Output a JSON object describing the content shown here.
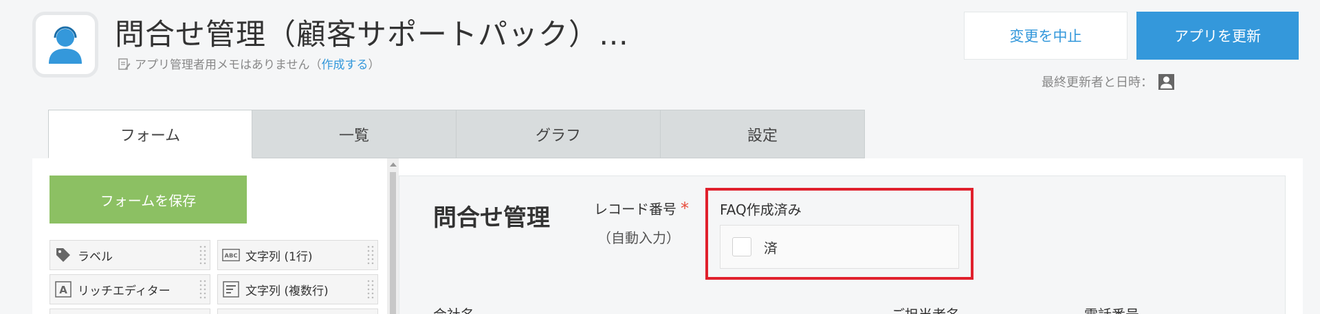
{
  "header": {
    "app_title": "問合せ管理（顧客サポートパック）…",
    "memo_text": "アプリ管理者用メモはありません（",
    "memo_link": "作成する",
    "memo_close": "）",
    "cancel_label": "変更を中止",
    "update_label": "アプリを更新",
    "last_updated_label": "最終更新者と日時："
  },
  "tabs": [
    {
      "label": "フォーム",
      "active": true
    },
    {
      "label": "一覧",
      "active": false
    },
    {
      "label": "グラフ",
      "active": false
    },
    {
      "label": "設定",
      "active": false
    }
  ],
  "palette": {
    "save_label": "フォームを保存",
    "items": [
      {
        "label": "ラベル",
        "icon": "tag-icon"
      },
      {
        "label": "文字列 (1行)",
        "icon": "abc-icon"
      },
      {
        "label": "リッチエディター",
        "icon": "rich-text-icon"
      },
      {
        "label": "文字列 (複数行)",
        "icon": "multiline-icon"
      }
    ]
  },
  "form": {
    "title": "問合せ管理",
    "record_number_label": "レコード番号",
    "required_mark": "*",
    "auto_input_label": "（自動入力）",
    "faq_label": "FAQ作成済み",
    "faq_option": "済",
    "company_label": "会社名",
    "contact_label": "ご担当者名",
    "phone_label": "電話番号"
  },
  "colors": {
    "accent": "#3498db",
    "save_green": "#8cc063",
    "highlight_red": "#e0202c"
  }
}
